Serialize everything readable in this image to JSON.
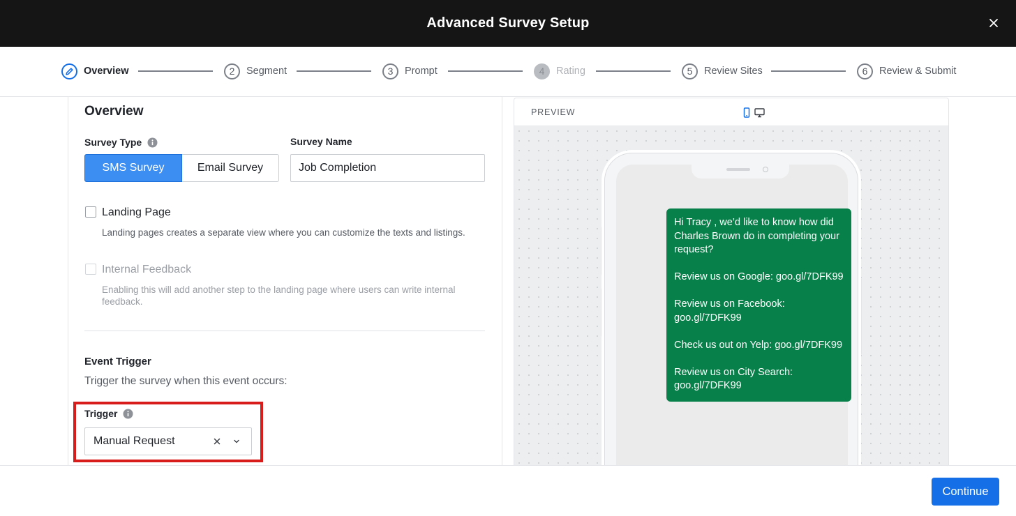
{
  "header": {
    "title": "Advanced Survey Setup",
    "close_icon": "close-icon"
  },
  "stepper": {
    "steps": [
      {
        "number": "",
        "label": "Overview",
        "state": "active",
        "icon": "pencil-icon"
      },
      {
        "number": "2",
        "label": "Segment",
        "state": "upcoming"
      },
      {
        "number": "3",
        "label": "Prompt",
        "state": "upcoming"
      },
      {
        "number": "4",
        "label": "Rating",
        "state": "disabled"
      },
      {
        "number": "5",
        "label": "Review Sites",
        "state": "upcoming"
      },
      {
        "number": "6",
        "label": "Review & Submit",
        "state": "upcoming"
      }
    ]
  },
  "form": {
    "section_title": "Overview",
    "survey_type_label": "Survey Type",
    "survey_type_options": [
      "SMS Survey",
      "Email Survey"
    ],
    "survey_type_selected": "SMS Survey",
    "survey_name_label": "Survey Name",
    "survey_name_value": "Job Completion",
    "landing_page": {
      "label": "Landing Page",
      "description": "Landing pages creates a separate view where you can customize the texts and listings.",
      "checked": false
    },
    "internal_feedback": {
      "label": "Internal Feedback",
      "description": "Enabling this will add another step to the landing page where users can write internal feedback.",
      "checked": false,
      "disabled": true
    },
    "event_trigger_title": "Event Trigger",
    "event_trigger_desc": "Trigger the survey when this event occurs:",
    "trigger_label": "Trigger",
    "trigger_value": "Manual Request"
  },
  "preview": {
    "label": "PREVIEW",
    "device_mobile_icon": "mobile-icon",
    "device_desktop_icon": "desktop-icon",
    "message_paragraphs": [
      "Hi Tracy , we’d like to know how did Charles Brown do in completing your request?",
      "Review us on Google: goo.gl/7DFK99",
      "Review us on Facebook: goo.gl/7DFK99",
      "Check us out on Yelp: goo.gl/7DFK99",
      "Review us on City Search: goo.gl/7DFK99"
    ]
  },
  "footer": {
    "continue_label": "Continue"
  },
  "colors": {
    "header_bg": "#151515",
    "accent": "#1570e8",
    "sms_bubble": "#08804a",
    "highlight_border": "#d81c1c"
  }
}
